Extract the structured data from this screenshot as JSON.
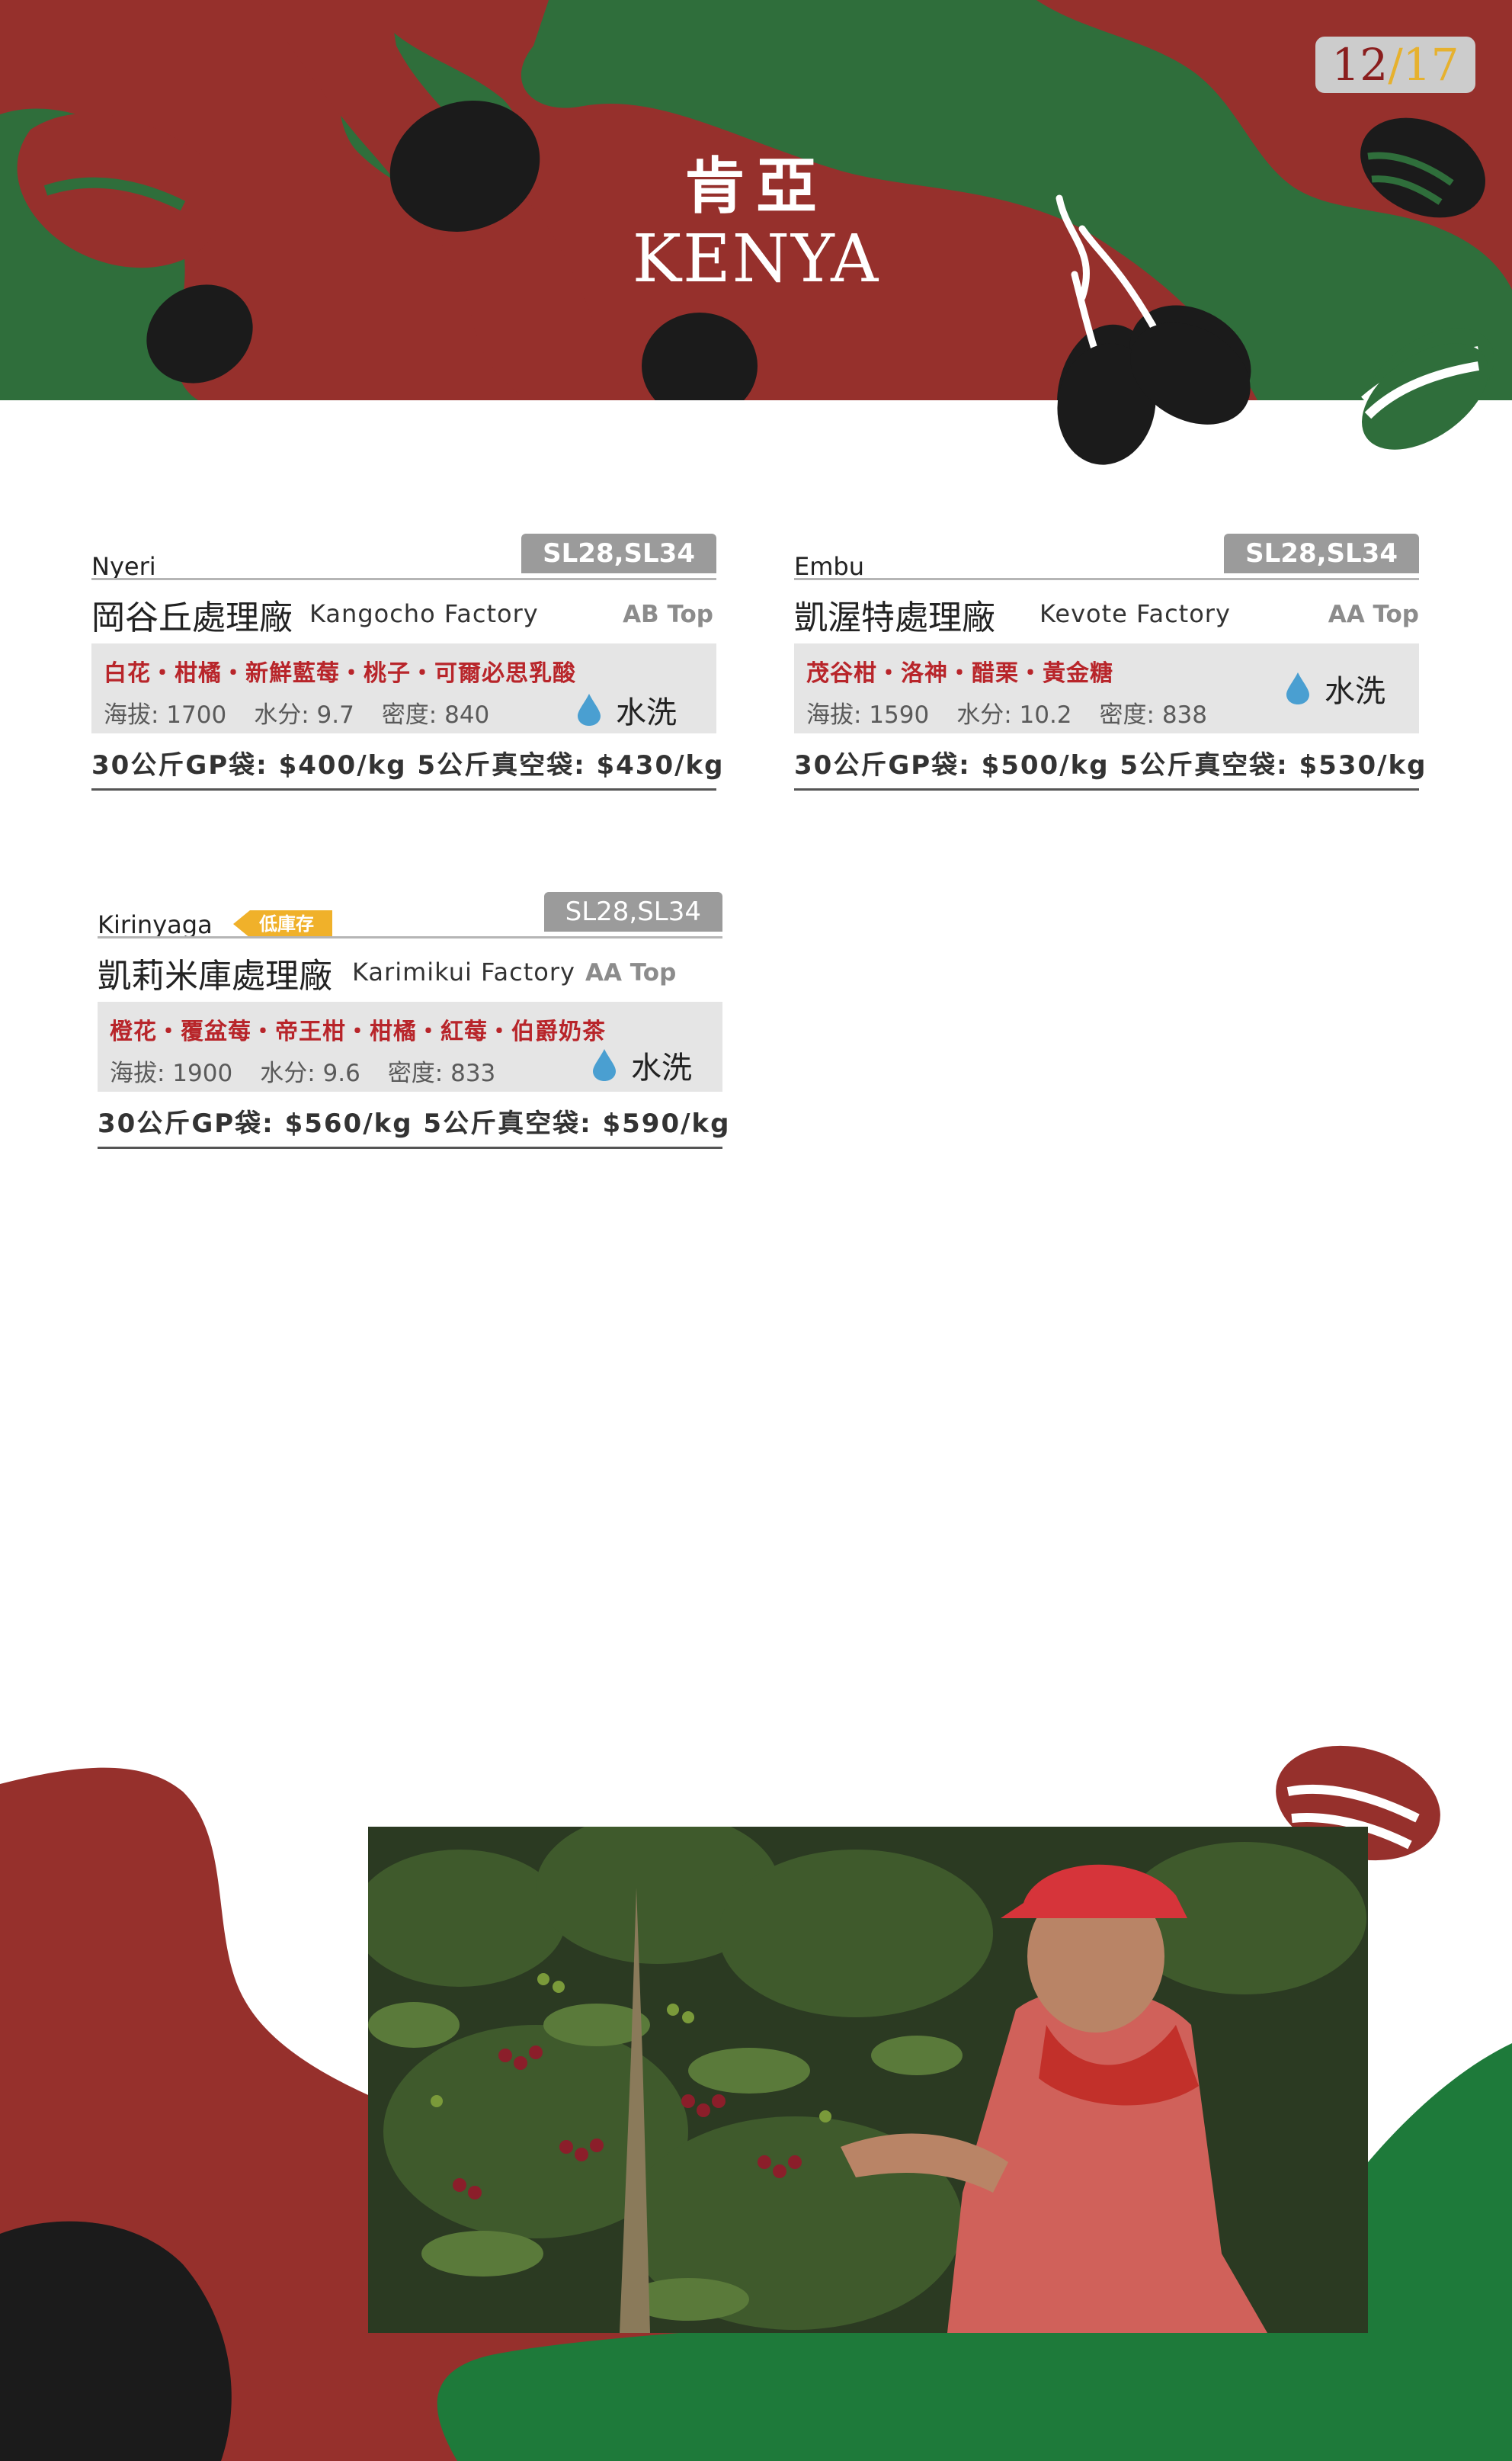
{
  "page": {
    "current": "12",
    "separator": "/",
    "total": "17"
  },
  "header": {
    "title_zh": "肯亞",
    "title_en": "KENYA"
  },
  "colors": {
    "red": "#96302c",
    "green": "#2f6e3b",
    "black": "#1b1b1b",
    "badge_gray": "#9b9b9b",
    "flavor_red": "#b8252a",
    "stock_yellow": "#f0b12a",
    "drop_blue": "#4a9fd1"
  },
  "cards": [
    {
      "region": "Nyeri",
      "variety": "SL28,SL34",
      "factory_zh": "岡谷丘處理廠",
      "factory_en": "Kangocho Factory",
      "grade": "AB Top",
      "flavors": "白花・柑橘・新鮮藍莓・桃子・可爾必思乳酸",
      "altitude": "海拔: 1700",
      "moisture": "水分: 9.7",
      "density": "密度: 840",
      "process": "水洗",
      "process_icon": "water-drop-icon",
      "price": "30公斤GP袋: $400/kg  5公斤真空袋: $430/kg"
    },
    {
      "region": "Embu",
      "variety": "SL28,SL34",
      "factory_zh": "凱渥特處理廠",
      "factory_en": "Kevote Factory",
      "grade": "AA Top",
      "flavors": "茂谷柑・洛神・醋栗・黃金糖",
      "altitude": "海拔: 1590",
      "moisture": "水分: 10.2",
      "density": "密度: 838",
      "process": "水洗",
      "process_icon": "water-drop-icon",
      "price": "30公斤GP袋: $500/kg  5公斤真空袋: $530/kg"
    },
    {
      "region": "Kirinyaga",
      "stock_badge": "低庫存",
      "variety": "SL28,SL34",
      "factory_zh": "凱莉米庫處理廠",
      "factory_en": "Karimikui Factory",
      "grade": "AA Top",
      "flavors": "橙花・覆盆莓・帝王柑・柑橘・紅莓・伯爵奶茶",
      "altitude": "海拔: 1900",
      "moisture": "水分: 9.6",
      "density": "密度: 833",
      "process": "水洗",
      "process_icon": "water-drop-icon",
      "price": "30公斤GP袋: $560/kg  5公斤真空袋: $590/kg"
    }
  ]
}
